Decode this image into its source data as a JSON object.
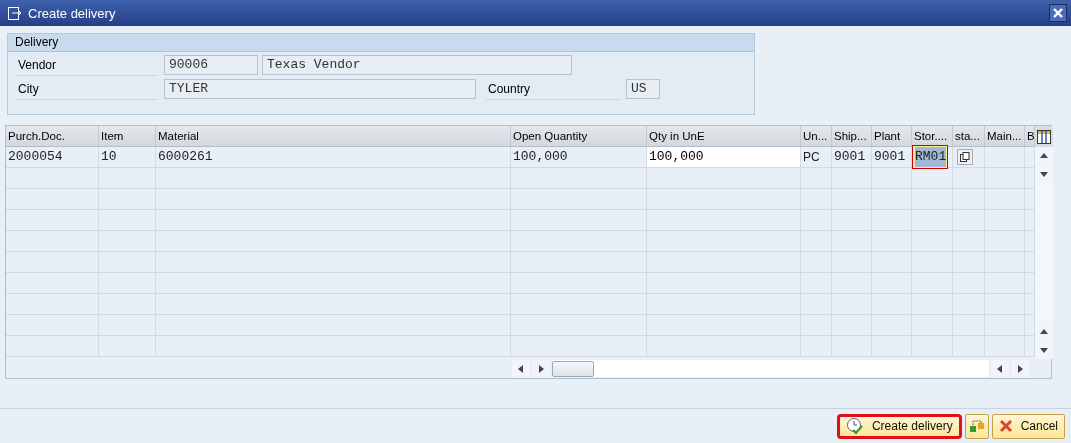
{
  "window": {
    "title": "Create delivery"
  },
  "delivery": {
    "title": "Delivery",
    "fields": [
      {
        "label": "Vendor",
        "value": "90006",
        "description": "Texas Vendor"
      },
      {
        "label": "City",
        "value": "TYLER"
      }
    ],
    "country": {
      "label": "Country",
      "value": "US"
    }
  },
  "table": {
    "columns": [
      "Purch.Doc.",
      "Item",
      "Material",
      "Open Quantity",
      "Qty in UnE",
      "Un...",
      "Ship...",
      "Plant",
      "Stor....",
      "sta...",
      "Main...",
      "B"
    ],
    "rows": [
      {
        "cells": [
          {
            "text": "2000054",
            "kind": "display"
          },
          {
            "text": "10",
            "kind": "display"
          },
          {
            "text": "6000261",
            "kind": "display"
          },
          {
            "text": "100,000",
            "kind": "display"
          },
          {
            "text": "100,000",
            "kind": "input"
          },
          {
            "text": "PC",
            "kind": "unit"
          },
          {
            "text": "9001",
            "kind": "display"
          },
          {
            "text": "9001",
            "kind": "display"
          },
          {
            "text": "RM01",
            "kind": "focused"
          },
          {
            "kind": "valuehelp"
          },
          {
            "kind": "display"
          },
          {
            "kind": "display"
          }
        ]
      }
    ]
  },
  "buttons": [
    {
      "label": "Create delivery",
      "kind": "confirm",
      "highlighted": true
    },
    {
      "kind": "icon"
    },
    {
      "label": "Cancel",
      "kind": "cancel"
    }
  ]
}
